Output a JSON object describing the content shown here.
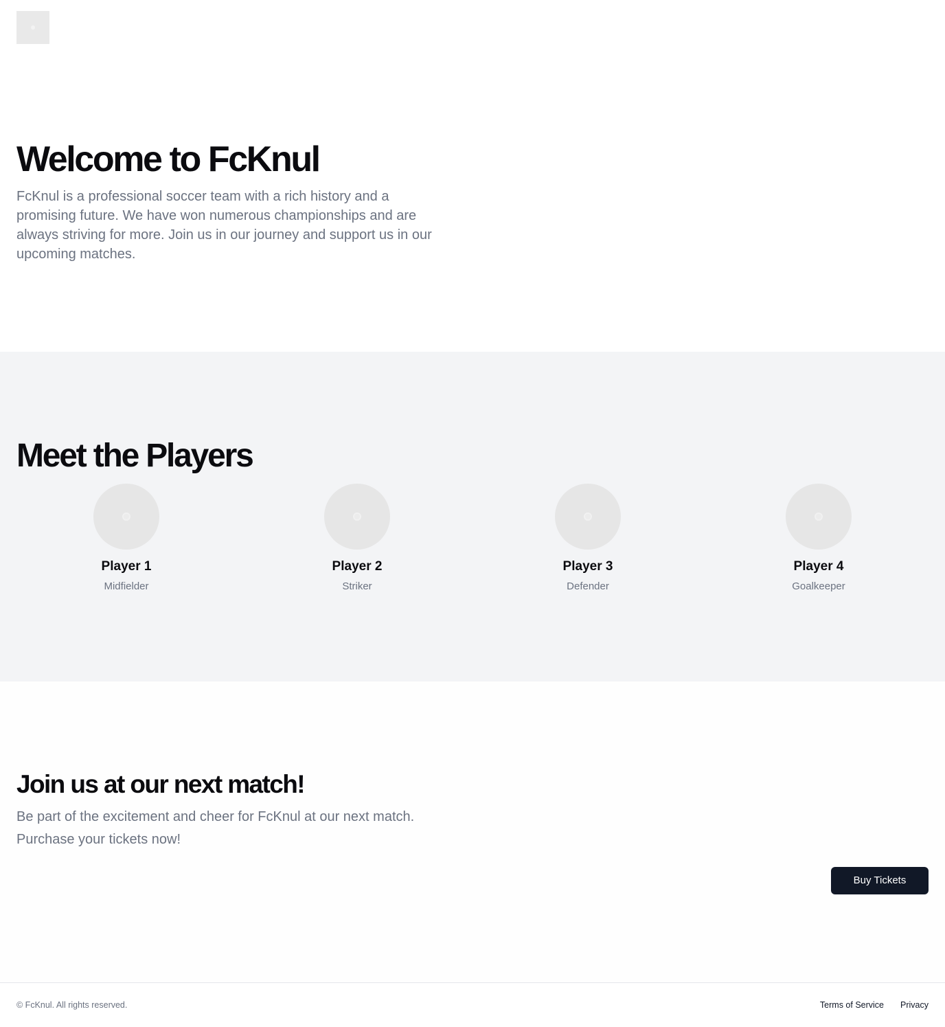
{
  "header": {
    "logo_icon": "placeholder-image-icon"
  },
  "hero": {
    "title": "Welcome to FcKnul",
    "description": "FcKnul is a professional soccer team with a rich history and a promising future. We have won numerous championships and are always striving for more. Join us in our journey and support us in our upcoming matches."
  },
  "players": {
    "title": "Meet the Players",
    "items": [
      {
        "name": "Player 1",
        "position": "Midfielder",
        "avatar_icon": "placeholder-image-icon"
      },
      {
        "name": "Player 2",
        "position": "Striker",
        "avatar_icon": "placeholder-image-icon"
      },
      {
        "name": "Player 3",
        "position": "Defender",
        "avatar_icon": "placeholder-image-icon"
      },
      {
        "name": "Player 4",
        "position": "Goalkeeper",
        "avatar_icon": "placeholder-image-icon"
      }
    ]
  },
  "match": {
    "title": "Join us at our next match!",
    "description": "Be part of the excitement and cheer for FcKnul at our next match. Purchase your tickets now!",
    "button_label": "Buy Tickets"
  },
  "footer": {
    "copyright": "© FcKnul. All rights reserved.",
    "links": [
      {
        "label": "Terms of Service"
      },
      {
        "label": "Privacy"
      }
    ]
  },
  "colors": {
    "text_primary": "#0b0b0f",
    "text_muted": "#6b7280",
    "section_bg": "#f3f4f6",
    "button_bg": "#111827",
    "placeholder": "#e6e6e6"
  }
}
